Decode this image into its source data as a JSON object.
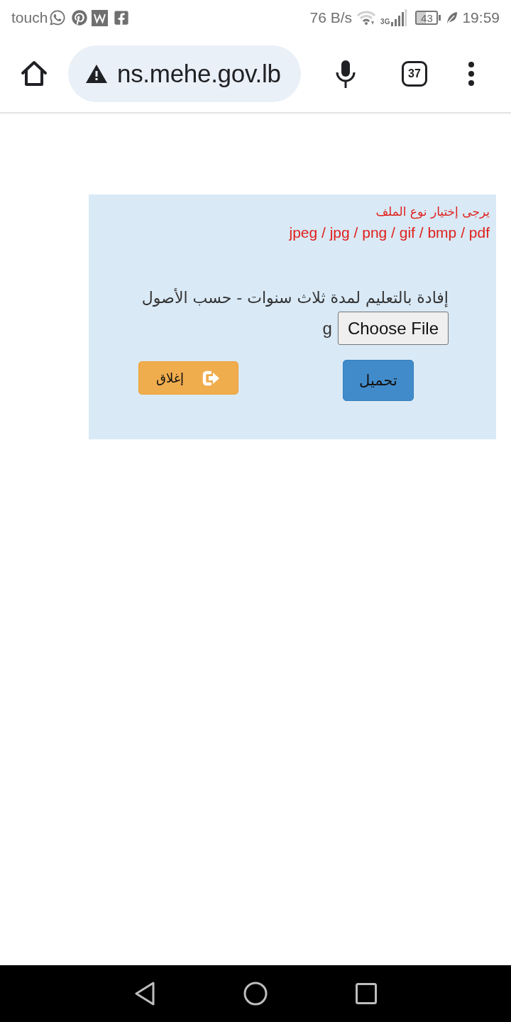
{
  "status_bar": {
    "carrier": "touch",
    "net_speed": "76 B/s",
    "network_type": "3G",
    "battery": "43",
    "time": "19:59"
  },
  "browser": {
    "url": "ns.mehe.gov.lb",
    "tab_count": "37"
  },
  "upload_panel": {
    "hint": "يرجى إختيار نوع الملف",
    "file_types": "jpeg / jpg / png / gif / bmp / pdf",
    "document_label": "إفادة بالتعليم لمدة ثلاث سنوات - حسب الأصول",
    "file_button": "Choose File",
    "file_name": "g",
    "buttons": [
      {
        "label": "تحميل",
        "kind": "primary"
      },
      {
        "label": "إغلاق",
        "kind": "close"
      }
    ]
  }
}
